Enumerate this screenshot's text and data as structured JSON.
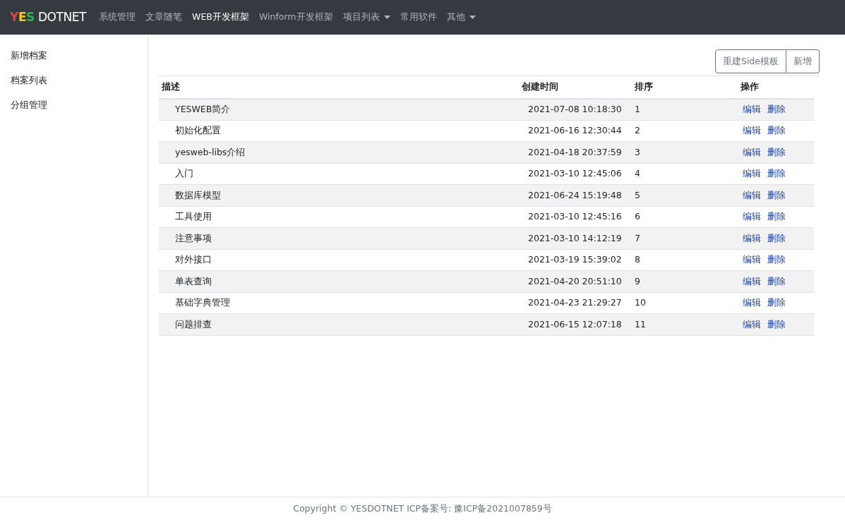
{
  "navbar": {
    "logo": {
      "letters": [
        {
          "char": "Y",
          "color": "#e8413b"
        },
        {
          "char": "E",
          "color": "#f5c518"
        },
        {
          "char": "S",
          "color": "#2fb34a"
        }
      ],
      "text": "DOTNET"
    },
    "items": [
      {
        "label": "系统管理",
        "selected": false,
        "dropdown": false
      },
      {
        "label": "文章随笔",
        "selected": false,
        "dropdown": false
      },
      {
        "label": "WEB开发框架",
        "selected": true,
        "dropdown": false
      },
      {
        "label": "Winform开发框架",
        "selected": false,
        "dropdown": false
      },
      {
        "label": "项目列表",
        "selected": false,
        "dropdown": true
      },
      {
        "label": "常用软件",
        "selected": false,
        "dropdown": false
      },
      {
        "label": "其他",
        "selected": false,
        "dropdown": true
      }
    ]
  },
  "sidebar": {
    "items": [
      "新增档案",
      "档案列表",
      "分组管理"
    ]
  },
  "toolbar": {
    "buttons": [
      "重建Side模板",
      "新增"
    ]
  },
  "table": {
    "columns": [
      "描述",
      "创建时间",
      "排序",
      "操作"
    ],
    "rows": [
      {
        "title": "YESWEB简介",
        "created": "2021-07-08 10:18:30",
        "order": "1",
        "actions": [
          "编辑",
          "删除"
        ]
      },
      {
        "title": "初始化配置",
        "created": "2021-06-16 12:30:44",
        "order": "2",
        "actions": [
          "编辑",
          "删除"
        ]
      },
      {
        "title": "yesweb-libs介绍",
        "created": "2021-04-18 20:37:59",
        "order": "3",
        "actions": [
          "编辑",
          "删除"
        ]
      },
      {
        "title": "入门",
        "created": "2021-03-10 12:45:06",
        "order": "4",
        "actions": [
          "编辑",
          "删除"
        ]
      },
      {
        "title": "数据库模型",
        "created": "2021-06-24 15:19:48",
        "order": "5",
        "actions": [
          "编辑",
          "删除"
        ]
      },
      {
        "title": "工具使用",
        "created": "2021-03-10 12:45:16",
        "order": "6",
        "actions": [
          "编辑",
          "删除"
        ]
      },
      {
        "title": "注意事项",
        "created": "2021-03-10 14:12:19",
        "order": "7",
        "actions": [
          "编辑",
          "删除"
        ]
      },
      {
        "title": "对外接口",
        "created": "2021-03-19 15:39:02",
        "order": "8",
        "actions": [
          "编辑",
          "删除"
        ]
      },
      {
        "title": "单表查询",
        "created": "2021-04-20 20:51:10",
        "order": "9",
        "actions": [
          "编辑",
          "删除"
        ]
      },
      {
        "title": "基础字典管理",
        "created": "2021-04-23 21:29:27",
        "order": "10",
        "actions": [
          "编辑",
          "删除"
        ]
      },
      {
        "title": "问题排查",
        "created": "2021-06-15 12:07:18",
        "order": "11",
        "actions": [
          "编辑",
          "删除"
        ]
      }
    ]
  },
  "footer": "Copyright © YESDOTNET ICP备案号: 豫ICP备2021007859号"
}
